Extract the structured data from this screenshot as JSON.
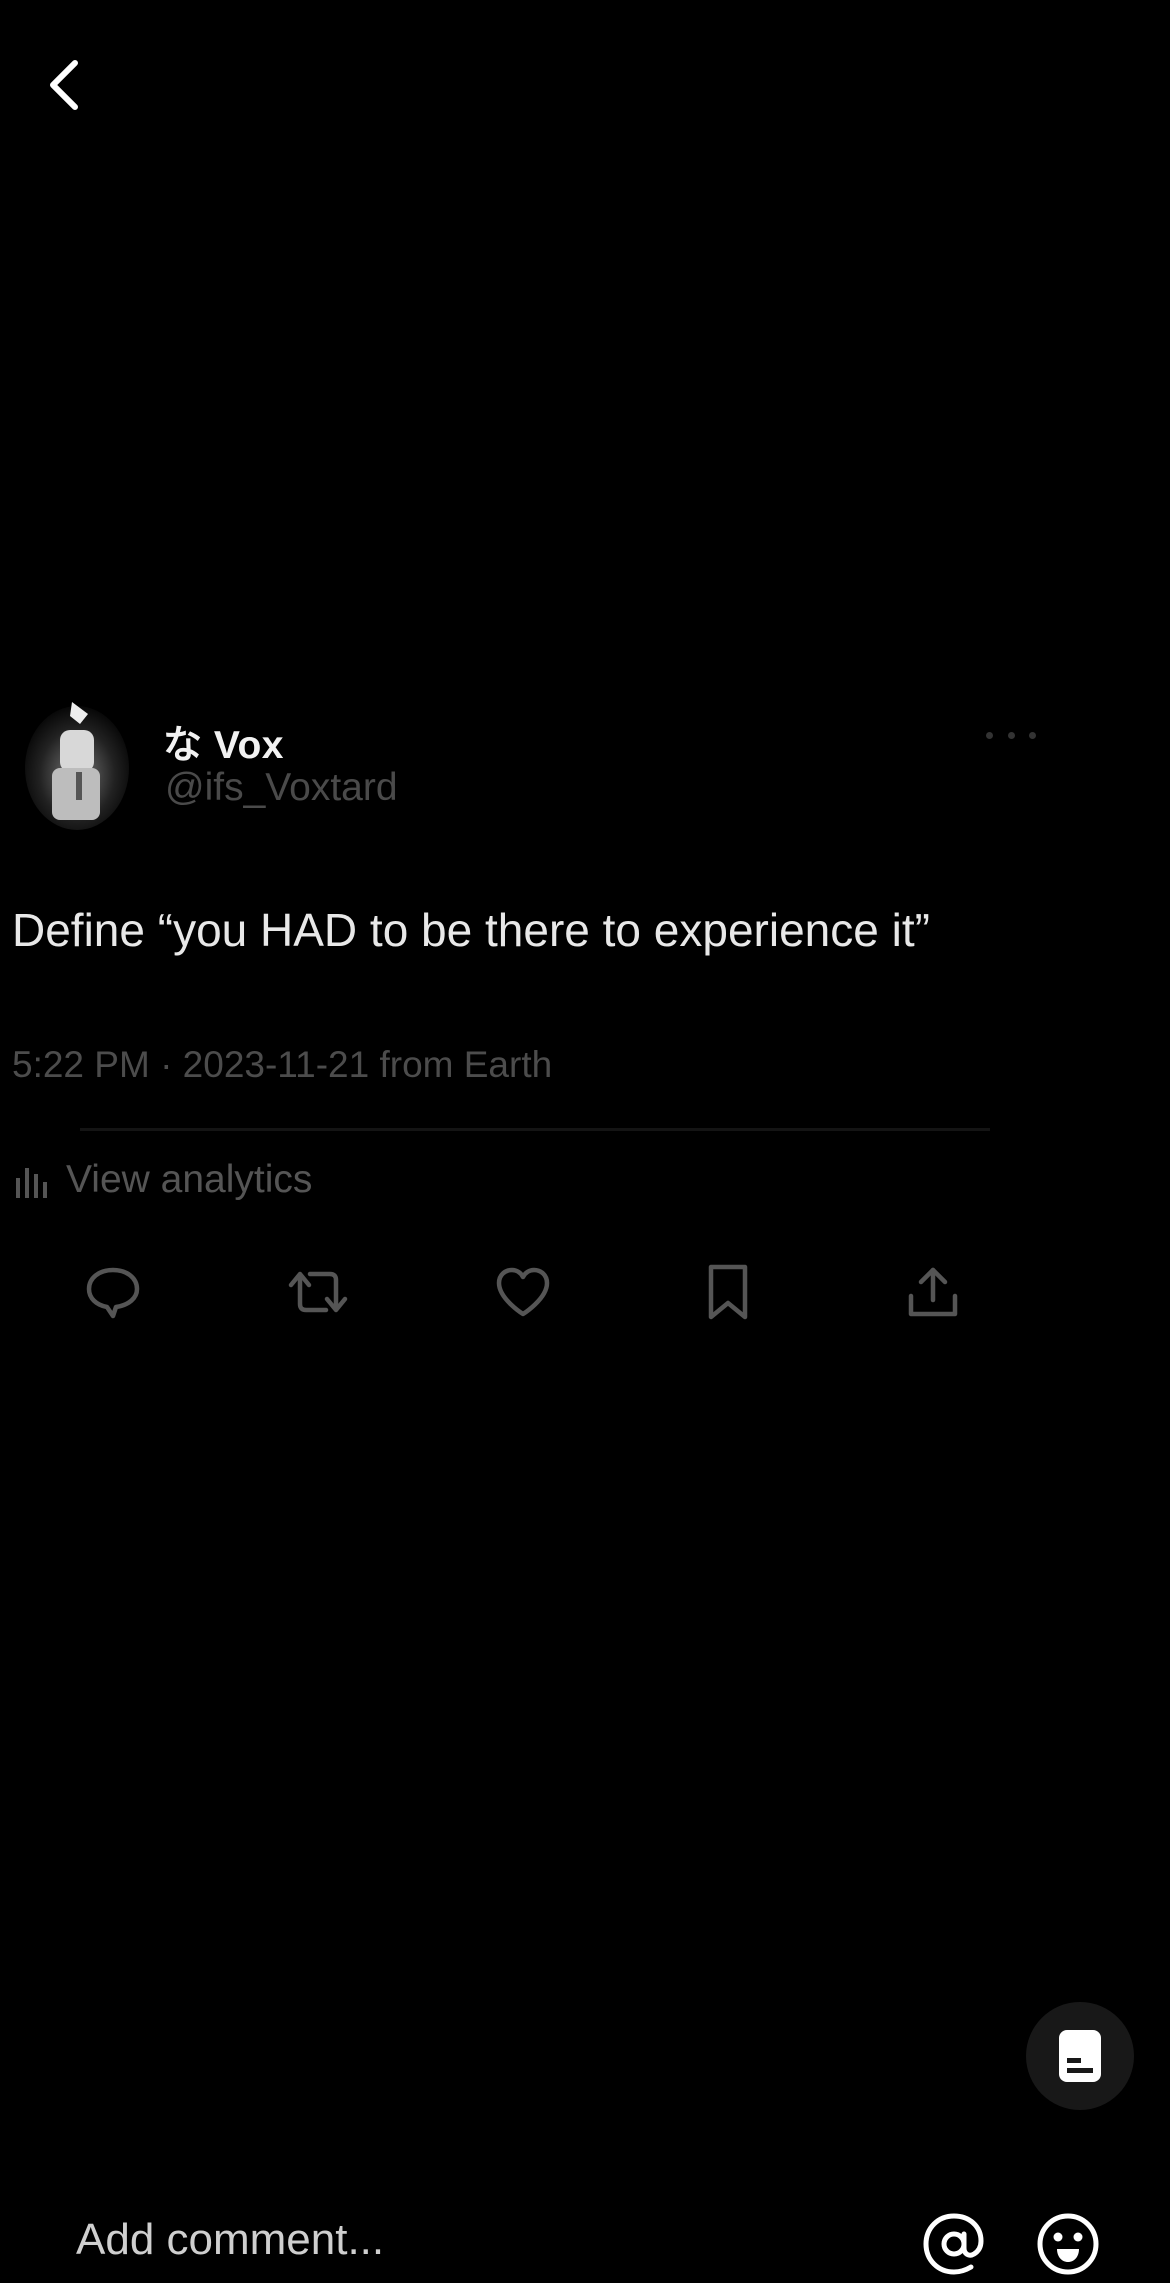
{
  "post": {
    "display_name": "な Vox",
    "handle": "@ifs_Voxtard",
    "text": "Define “you HAD to be there to experience it”",
    "timestamp": "5:22 PM · 2023-11-21 from Earth",
    "analytics_label": "View analytics"
  },
  "comment_bar": {
    "placeholder": "Add comment..."
  },
  "icons": {
    "back": "chevron-left-icon",
    "more": "more-horizontal-icon",
    "analytics": "bar-chart-icon",
    "reply": "comment-bubble-icon",
    "repost": "repost-icon",
    "like": "heart-icon",
    "bookmark": "bookmark-icon",
    "share": "share-upload-icon",
    "fab": "document-icon",
    "mention": "at-sign-icon",
    "emoji": "emoji-icon"
  },
  "colors": {
    "background": "#000000",
    "text_primary": "#E8E8E8",
    "text_muted": "#4C4C4C",
    "icon_muted": "#555555"
  }
}
